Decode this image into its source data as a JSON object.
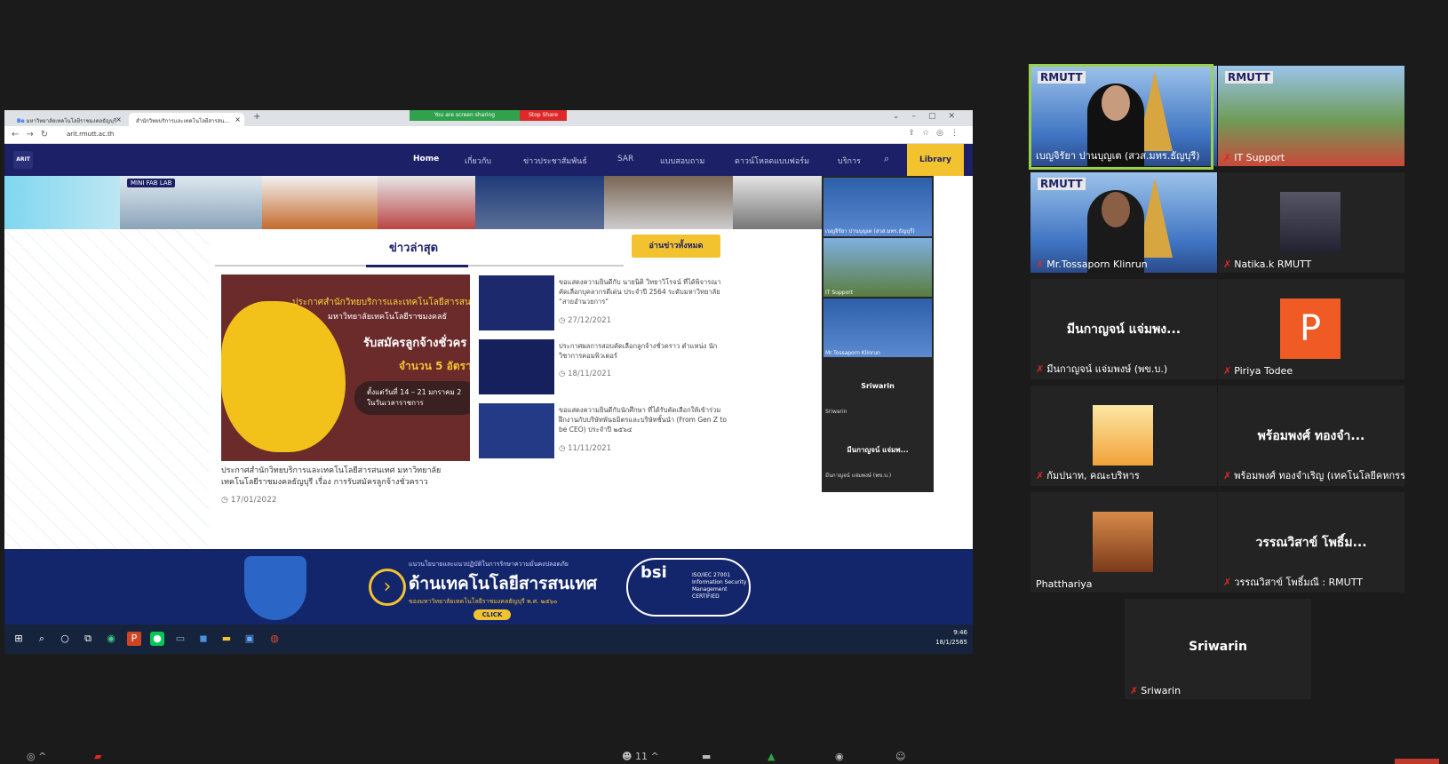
{
  "browser": {
    "tabs": [
      {
        "icon": "Be",
        "label": "มหาวิทยาลัยเทคโนโลยีราชมงคลธัญบุรี"
      },
      {
        "icon": "",
        "label": "สำนักวิทยบริการและเทคโนโลยีสารสน..."
      }
    ],
    "new_tab": "+",
    "url": "arit.rmutt.ac.th",
    "sharing_text": "You are screen sharing",
    "stop_share": "Stop Share"
  },
  "site": {
    "logo_text": "ARIT",
    "nav": [
      "Home",
      "เกี่ยวกับ",
      "ข่าวประชาสัมพันธ์",
      "SAR",
      "แบบสอบถาม",
      "ดาวน์โหลดแบบฟอร์ม",
      "บริการ"
    ],
    "library": "Library",
    "banner_title": "MINI FAB LAB",
    "news_heading": "ข่าวล่าสุด",
    "read_all": "อ่านข่าวทั้งหมด",
    "feature": {
      "img_line1": "ประกาศสำนักวิทยบริการและเทคโนโลยีสารสนเ",
      "img_line2": "มหาวิทยาลัยเทคโนโลยีราชมงคลธั",
      "img_line3": "รับสมัครลูกจ้างชั่วคร",
      "img_line4": "จำนวน 5 อัตรา",
      "img_pill": "ตั้งแต่วันที่ 14 – 21 มกราคม 2 ในวันเวลาราชการ",
      "title": "ประกาศสำนักวิทยบริการและเทคโนโลยีสารสนเทศ มหาวิทยาลัยเทคโนโลยีราชมงคลธัญบุรี เรื่อง การรับสมัครลูกจ้างชั่วคราว",
      "date": "17/01/2022"
    },
    "news": [
      {
        "title": "ขอแสดงความยินดีกับ นายนิติ วิทยาวิโรจน์ ที่ได้พิจารณาคัดเลือกบุคลากรดีเด่น ประจำปี 2564 ระดับมหาวิทยาลัย “สายอำนวยการ”",
        "date": "27/12/2021"
      },
      {
        "title": "ประกาศผลการสอบคัดเลือกลูกจ้างชั่วคราว ตำแหน่ง นักวิชาการคอมพิวเตอร์",
        "date": "18/11/2021"
      },
      {
        "title": "ขอแสดงความยินดีกับนักศึกษา ที่ได้รับคัดเลือกให้เข้าร่วมฝึกงานกับบริษัทพันธมิตรและบริษัทชั้นนำ (From Gen Z to be CEO) ประจำปี ๒๕๖๔",
        "date": "11/11/2021"
      }
    ],
    "inner_gallery": [
      "เบญจิรัยา ปานบุญเต (สวส.มทร.ธัญบุรี)",
      "IT Support",
      "Mr.Tossaporn Klinrun"
    ],
    "inner_names": [
      "Sriwarin",
      "มีนกาญจน์ แจ่มพ..."
    ],
    "inner_labels": [
      "Sriwarin",
      "มีนกาญจน์ แจ่มพงษ์ (พข.บ.)"
    ],
    "footer": {
      "line1": "แนวนโยบายและแนวปฏิบัติในการรักษาความมั่นคงปลอดภัย",
      "line2": "ด้านเทคโนโลยีสารสนเทศ",
      "line3": "ของมหาวิทยาลัยเทคโนโลยีราชมงคลธัญบุรี พ.ศ. ๒๕๖๐",
      "click": "CLICK",
      "bsi": "bsi",
      "iso": "ISO/IEC 27001 Information Security Management CERTIFIED"
    },
    "clock_time": "9:46",
    "clock_date": "18/1/2565"
  },
  "participants": [
    {
      "name": "เบญจิรัยา ปานบุญเต (สวส.มทร.ธัญบุรี)",
      "type": "video"
    },
    {
      "name": "IT Support",
      "type": "video"
    },
    {
      "name": "Mr.Tossaporn Klinrun",
      "type": "video"
    },
    {
      "name": "Natika.k RMUTT",
      "type": "photo"
    },
    {
      "name": "มีนกาญจน์ แจ่มพงษ์ (พข.บ.)",
      "display": "มีนกาญจน์ แจ่มพง...",
      "type": "text"
    },
    {
      "name": "Piriya Todee",
      "display": "P",
      "type": "letter"
    },
    {
      "name": "กัมปนาท, คณะบริหาร",
      "type": "photo"
    },
    {
      "name": "พร้อมพงศ์ ทองจำเริญ (เทคโนโลยีคหกรรม...",
      "display": "พร้อมพงศ์ ทองจำ...",
      "type": "text"
    },
    {
      "name": "Phatthariya",
      "type": "photo"
    },
    {
      "name": "วรรณวิสาข์ โพธิ์มณี : RMUTT",
      "display": "วรรณวิสาข์ โพธิ์ม...",
      "type": "text"
    },
    {
      "name": "Sriwarin",
      "display": "Sriwarin",
      "type": "text"
    }
  ],
  "zoom_toolbar": {
    "participants_count": "11"
  },
  "colors": {
    "site_nav": "#1c2066",
    "accent_yellow": "#f3c32f",
    "active_speaker": "#9bd04a",
    "share_green": "#31a24c",
    "stop_red": "#e02828",
    "piriya_avatar": "#f05a24"
  }
}
